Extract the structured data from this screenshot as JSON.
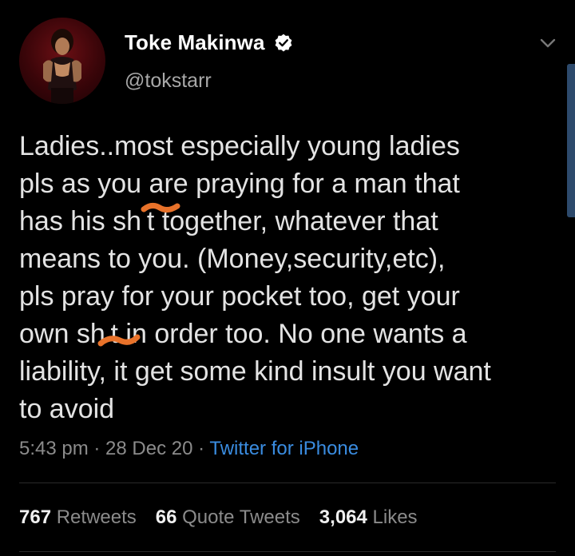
{
  "author": {
    "name": "Toke Makinwa",
    "handle": "@tokstarr",
    "verified_icon": "verified-badge-icon"
  },
  "tweet": {
    "lines": [
      "Ladies..most especially young ladies",
      "pls as you are praying for a man that",
      "has his sh t together, whatever that",
      "means to you. (Money,security,etc),",
      "pls pray for your pocket too, get your",
      "own sh t in order too. No one wants a",
      "liability, it get some kind insult you want",
      "to avoid"
    ]
  },
  "meta": {
    "time": "5:43 pm",
    "sep1": " · ",
    "date": "28 Dec 20",
    "sep2": " · ",
    "source": "Twitter for iPhone"
  },
  "stats": {
    "retweets_count": "767",
    "retweets_label": "Retweets",
    "quotes_count": "66",
    "quotes_label": "Quote Tweets",
    "likes_count": "3,064",
    "likes_label": "Likes"
  },
  "colors": {
    "background": "#000000",
    "link": "#3a8ce0",
    "scribble": "#e8722a"
  }
}
